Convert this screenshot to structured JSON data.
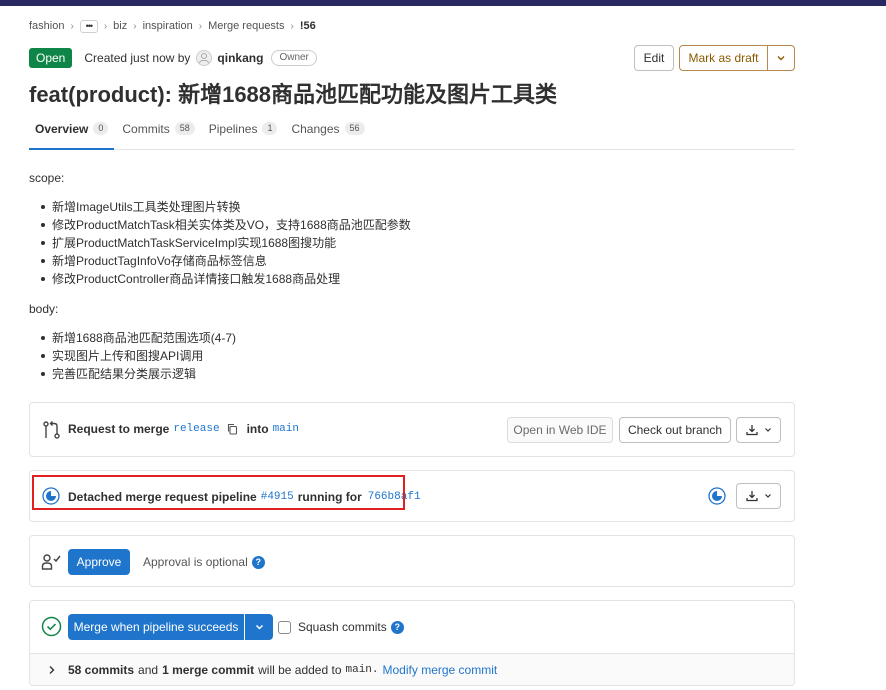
{
  "breadcrumb": {
    "items": [
      "fashion",
      "biz",
      "inspiration",
      "Merge requests",
      "!56"
    ],
    "more": "•••",
    "separator": "›"
  },
  "header": {
    "status": "Open",
    "created_text": "Created just now by",
    "author": "qinkang",
    "author_role": "Owner",
    "edit_label": "Edit",
    "draft_label": "Mark as draft",
    "title": "feat(product): 新增1688商品池匹配功能及图片工具类"
  },
  "tabs": [
    {
      "label": "Overview",
      "count": "0",
      "active": true
    },
    {
      "label": "Commits",
      "count": "58",
      "active": false
    },
    {
      "label": "Pipelines",
      "count": "1",
      "active": false
    },
    {
      "label": "Changes",
      "count": "56",
      "active": false
    }
  ],
  "description": {
    "scope_label": "scope:",
    "scope_items": [
      "新增ImageUtils工具类处理图片转换",
      "修改ProductMatchTask相关实体类及VO，支持1688商品池匹配参数",
      "扩展ProductMatchTaskServiceImpl实现1688图搜功能",
      "新增ProductTagInfoVo存储商品标签信息",
      "修改ProductController商品详情接口触发1688商品处理"
    ],
    "body_label": "body:",
    "body_items": [
      "新增1688商品池匹配范围选项(4-7)",
      "实现图片上传和图搜API调用",
      "完善匹配结果分类展示逻辑"
    ]
  },
  "merge_info": {
    "request_text": "Request to merge",
    "source_branch": "release",
    "into_text": "into",
    "target_branch": "main",
    "web_ide_label": "Open in Web IDE",
    "checkout_label": "Check out branch"
  },
  "pipeline": {
    "text": "Detached merge request pipeline",
    "id": "#4915",
    "running_text": "running for",
    "commit": "766b8af1"
  },
  "approval": {
    "approve_label": "Approve",
    "optional_text": "Approval is optional"
  },
  "merge_action": {
    "merge_label": "Merge when pipeline succeeds",
    "squash_label": "Squash commits",
    "commits_count": "58 commits",
    "and_text": "and",
    "merge_commit": "1 merge commit",
    "will_be_added": "will be added to",
    "target": "main.",
    "modify_label": "Modify merge commit"
  },
  "colors": {
    "accent": "#1f75cb",
    "open_badge": "#108548",
    "draft_border": "#b5894b",
    "highlight_border": "#e02020",
    "topbar": "#292961"
  }
}
